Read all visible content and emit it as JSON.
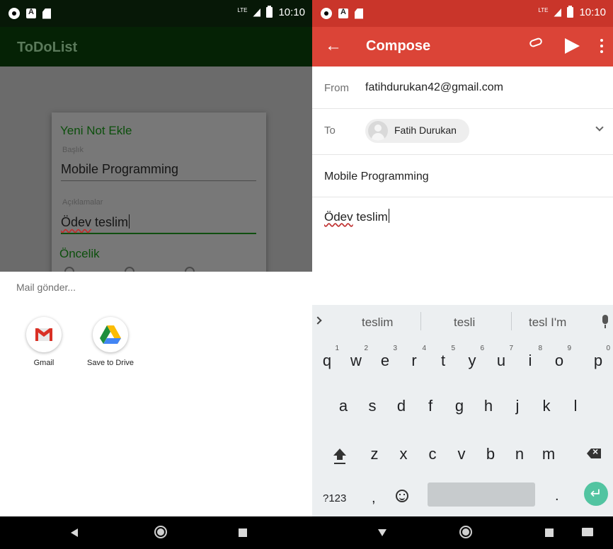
{
  "status_bar": {
    "time": "10:10",
    "network": "LTE"
  },
  "left": {
    "app_title": "ToDoList",
    "dialog": {
      "title": "Yeni Not Ekle",
      "title_field_label": "Başlık",
      "title_field_value": "Mobile Programming",
      "desc_field_label": "Açıklamalar",
      "desc_word1": "Ödev",
      "desc_word2": "teslim",
      "priority_label": "Öncelik"
    },
    "share_sheet": {
      "title": "Mail gönder...",
      "items": [
        {
          "label": "Gmail",
          "icon": "gmail-icon"
        },
        {
          "label": "Save to Drive",
          "icon": "google-drive-icon"
        }
      ]
    }
  },
  "right": {
    "toolbar": {
      "title": "Compose"
    },
    "from_label": "From",
    "from_value": "fatihdurukan42@gmail.com",
    "to_label": "To",
    "to_chip": "Fatih Durukan",
    "subject": "Mobile Programming",
    "body_word1": "Ödev",
    "body_word2": "teslim",
    "keyboard": {
      "suggestions": [
        "teslim",
        "tesli",
        "tesl I'm"
      ],
      "row1": [
        {
          "key": "q",
          "num": "1"
        },
        {
          "key": "w",
          "num": "2"
        },
        {
          "key": "e",
          "num": "3"
        },
        {
          "key": "r",
          "num": "4"
        },
        {
          "key": "t",
          "num": "5"
        },
        {
          "key": "y",
          "num": "6"
        },
        {
          "key": "u",
          "num": "7"
        },
        {
          "key": "i",
          "num": "8"
        },
        {
          "key": "o",
          "num": "9"
        },
        {
          "key": "p",
          "num": "0"
        }
      ],
      "row2": [
        "a",
        "s",
        "d",
        "f",
        "g",
        "h",
        "j",
        "k",
        "l"
      ],
      "row3": [
        "z",
        "x",
        "c",
        "v",
        "b",
        "n",
        "m"
      ],
      "symbols_key": "?123",
      "comma_key": ",",
      "period_key": "."
    }
  },
  "colors": {
    "todo_app_bar": "#052205",
    "gmail_red": "#db4437",
    "enter_key": "#52c4a1"
  }
}
